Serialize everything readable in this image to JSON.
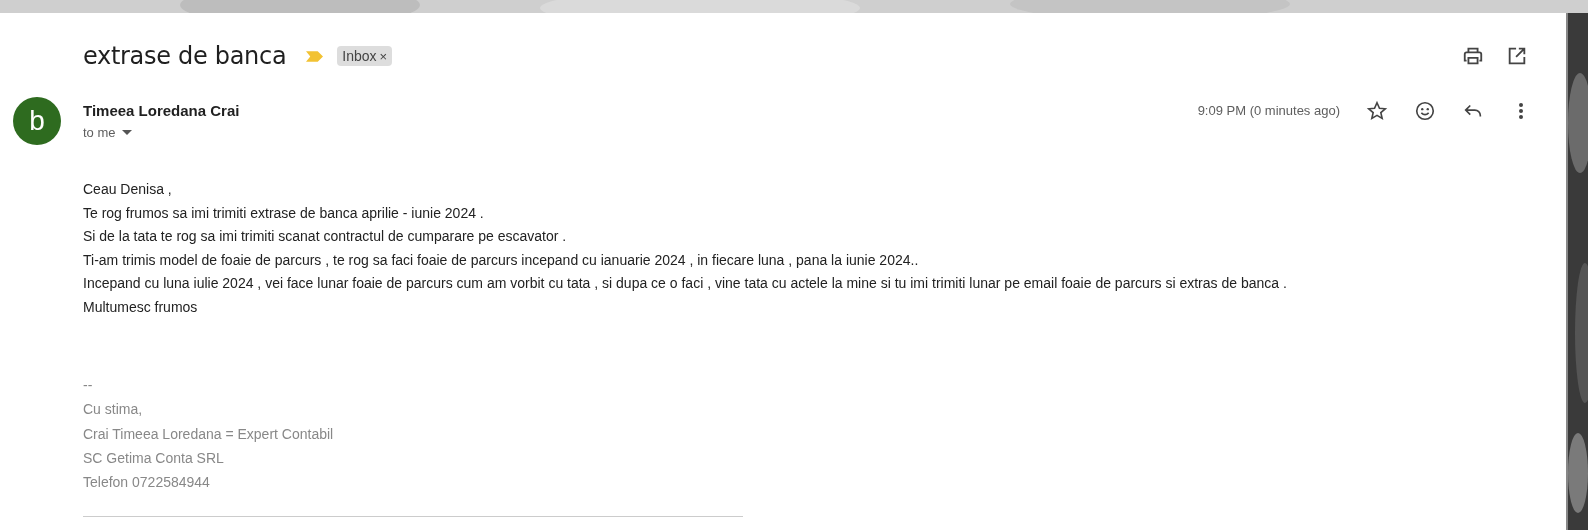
{
  "subject": "extrase de banca",
  "important": true,
  "labels": [
    {
      "text": "Inbox",
      "remove": "×"
    }
  ],
  "sender": {
    "avatar": "b",
    "name": "Timeea Loredana Crai",
    "to": "to me",
    "time": "9:09 PM (0 minutes ago)",
    "starred": false
  },
  "body": [
    "Ceau Denisa ,",
    "Te rog frumos sa imi trimiti extrase de banca aprilie - iunie 2024 .",
    "Si de la tata te rog sa imi trimiti scanat contractul de cumparare pe escavator .",
    "Ti-am trimis model de foaie de parcurs ,  te rog sa faci foaie de parcurs incepand cu ianuarie 2024 , in fiecare luna , pana la iunie 2024..",
    "Incepand cu luna iulie 2024 , vei face lunar foaie de parcurs  cum am vorbit cu tata , si dupa ce o faci , vine tata cu actele la mine si tu imi trimiti lunar pe email foaie de parcurs si extras de banca .",
    "Multumesc frumos"
  ],
  "signature": [
    "--",
    "Cu stima,",
    "Crai Timeea Loredana = Expert Contabil",
    "SC Getima Conta SRL",
    "Telefon 0722584944"
  ]
}
